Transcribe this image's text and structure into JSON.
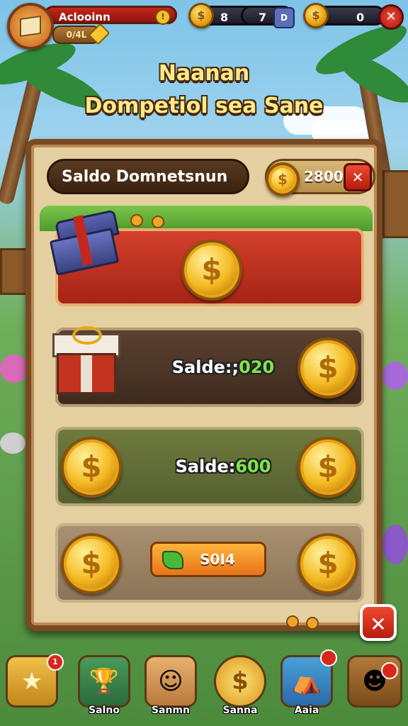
{
  "topbar": {
    "player_name": "Aclooinn",
    "level_text": "0/4L",
    "resource_a_value": "8",
    "resource_b_value": "7",
    "resource_b_btn": "D",
    "coins_value": "0"
  },
  "title": {
    "line1": "Naanan",
    "line2": "Dompetiol sea Sane"
  },
  "panel": {
    "header": "Saldo Domnetsnun",
    "balance": "2800",
    "rows": [
      {
        "label_prefix": "",
        "label_value": ""
      },
      {
        "label_prefix": "Salde:;",
        "label_value": "020"
      },
      {
        "label_prefix": "Salde:",
        "label_value": "600"
      },
      {
        "button": "S0I4"
      }
    ]
  },
  "nav": {
    "items": [
      {
        "label": "",
        "icon": "star-icon",
        "badge": "1"
      },
      {
        "label": "Salno",
        "icon": "trophy-icon"
      },
      {
        "label": "Sanmn",
        "icon": "character-icon"
      },
      {
        "label": "Sanna",
        "icon": "coin-icon",
        "badge": ""
      },
      {
        "label": "Aaia",
        "icon": "shop-icon",
        "badge": ""
      },
      {
        "label": "",
        "icon": "avatar-icon",
        "badge": ""
      }
    ]
  },
  "colors": {
    "accent_gold": "#f4bc24",
    "close_red": "#d32a1c",
    "panel_wood": "#7a4a22"
  }
}
